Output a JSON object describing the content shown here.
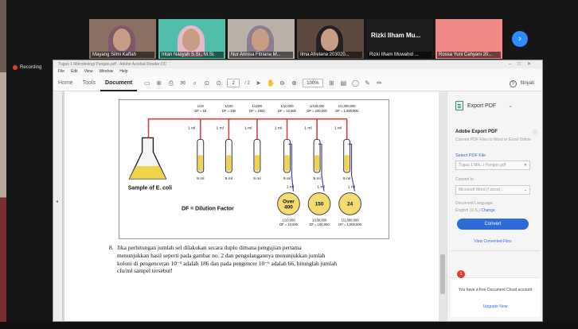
{
  "participants": [
    {
      "name": "Mayang Silmi Kaffah",
      "scene": "#8a6f63",
      "hijab": "#7d5a68"
    },
    {
      "name": "Intan Nasyah S.Si., M.Si.",
      "scene": "#4fbfaa",
      "hijab": "#e8b9c8"
    },
    {
      "name": "Nur Annisa Fitriana M...",
      "scene": "#b9b0a8",
      "hijab": "#8d7e8f"
    },
    {
      "name": "Ilma Afrelana 203020...",
      "scene": "#5c4a3e",
      "hijab": "#222222"
    },
    {
      "name": "Rizki Ilham Muwahid ...",
      "title": "Rizki Ilham Mu..."
    },
    {
      "name": "Rossa Yuni Cahyani 20..."
    }
  ],
  "recording_label": "Recording",
  "acrobat": {
    "window_title": "Tugas 1 Mikrobiologi Pangan.pdf - Adobe Acrobat Reader DC",
    "menu": [
      "File",
      "Edit",
      "View",
      "Window",
      "Help"
    ],
    "tabs": [
      "Home",
      "Tools",
      "Document"
    ],
    "active_tab": "Document",
    "page_current": "2",
    "page_total": "/ 2",
    "zoom": "100%",
    "user": "fitriyati",
    "figure": {
      "labels_top": [
        [
          "1/10",
          "DF = 10"
        ],
        [
          "1/100",
          "DF = 100"
        ],
        [
          "1/1000",
          "DF = 1000"
        ],
        [
          "1/10,000",
          "DF = 10,000"
        ],
        [
          "1/100,000",
          "DF = 100,000"
        ],
        [
          "1/1,000,000",
          "DF = 1,000,000"
        ]
      ],
      "transfer_label": "1 ml",
      "tube_volume": "9 ml",
      "flask_label": "Sample of E. coli",
      "df_label": "DF = Dilution Factor",
      "plates": [
        {
          "count": "Over 400",
          "dilution": "1/10,000",
          "df": "DF = 10,000"
        },
        {
          "count": "150",
          "dilution": "1/100,000",
          "df": "DF = 100,000"
        },
        {
          "count": "24",
          "dilution": "1/1,000,000",
          "df": "DF = 1,000,000"
        }
      ]
    },
    "question": {
      "number": "8.",
      "lines": [
        "Jika perhitungan jumlah sel dilakukan secara duplo dimana pengujian pertama",
        "menunjukkan hasil seperti pada gambar no. 2 dan pengulangannya menunjukkan jumlah",
        "koloni di pengenceran 10⁻⁵ adalah 186 dan pada pengencer 10⁻⁶ adalah 66, hitunglah jumlah",
        "cfu/ml sampel tersebut!"
      ]
    },
    "right_pane": {
      "export_title": "Export PDF",
      "panel_heading": "Adobe Export PDF",
      "description": "Convert PDF Files to Word or Excel Online",
      "select_file": "Select PDF File",
      "file_name": "Tugas 1 Mik...i Pangan.pdf",
      "convert_to_label": "Convert to",
      "convert_to_value": "Microsoft Word (*.docx)",
      "doc_language_label": "Document Language:",
      "doc_language_value": "English (U.S.)",
      "change_label": "Change",
      "convert_button": "Convert",
      "view_converted": "View Converted Files",
      "cloud_text": "You have a free Document Cloud account",
      "upgrade": "Upgrade Now",
      "badge": "1"
    }
  }
}
